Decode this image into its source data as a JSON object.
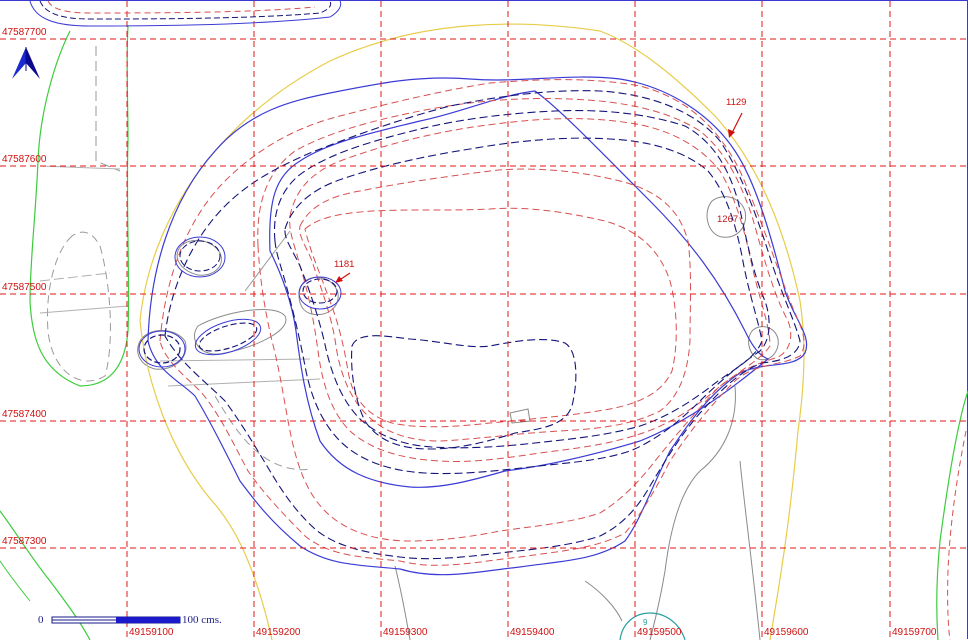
{
  "map": {
    "grid": {
      "x_labels": [
        "49159100",
        "49159200",
        "49159300",
        "49159400",
        "49159500",
        "49159600",
        "49159700"
      ],
      "y_labels": [
        "47587700",
        "47587600",
        "47587500",
        "47587400",
        "47587300"
      ],
      "line_color": "#e01818",
      "label_color": "#d01010"
    },
    "annotations": {
      "point_1129": "1129",
      "point_1181": "1181",
      "point_1267": "1267",
      "point_small": "9"
    },
    "scale_bar": {
      "start": "0",
      "end_label": "100 cms."
    },
    "north_arrow": {
      "icon": "north-arrow-icon",
      "color": "#1a2ad0"
    },
    "colors": {
      "contour_blue": "#3b3bd6",
      "contour_navy": "#14147a",
      "contour_red_dashed": "#d85050",
      "outline_yellow": "#e8cc4a",
      "outline_green": "#3ccc3c",
      "outline_gray": "#8a8a8a",
      "outline_teal": "#2aa0a0"
    }
  }
}
